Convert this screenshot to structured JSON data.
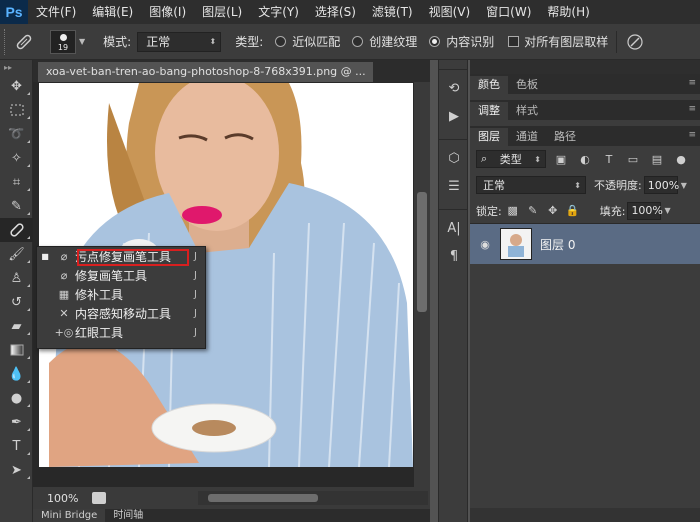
{
  "menubar": {
    "logo": "Ps",
    "items": [
      "文件(F)",
      "编辑(E)",
      "图像(I)",
      "图层(L)",
      "文字(Y)",
      "选择(S)",
      "滤镜(T)",
      "视图(V)",
      "窗口(W)",
      "帮助(H)"
    ]
  },
  "options": {
    "brush_size": "19",
    "mode_label": "模式:",
    "mode_value": "正常",
    "type_label": "类型:",
    "radio_proximity": "近似匹配",
    "radio_texture": "创建纹理",
    "radio_content_aware": "内容识别",
    "sample_all_layers": "对所有图层取样"
  },
  "document": {
    "tab_title": "xoa-vet-ban-tren-ao-bang-photoshop-8-768x391.png @ ...",
    "zoom": "100%"
  },
  "bottom_tabs": [
    "Mini Bridge",
    "时间轴"
  ],
  "flyout": {
    "items": [
      {
        "label": "污点修复画笔工具",
        "key": "J"
      },
      {
        "label": "修复画笔工具",
        "key": "J"
      },
      {
        "label": "修补工具",
        "key": "J"
      },
      {
        "label": "内容感知移动工具",
        "key": "J"
      },
      {
        "label": "红眼工具",
        "key": "J"
      }
    ]
  },
  "panels": {
    "row1_tabs": [
      "颜色",
      "色板"
    ],
    "row2_tabs": [
      "调整",
      "样式"
    ],
    "layers_tabs": [
      "图层",
      "通道",
      "路径"
    ],
    "kind_label": "类型",
    "blend_mode": "正常",
    "opacity_label": "不透明度:",
    "opacity_value": "100%",
    "lock_label": "锁定:",
    "fill_label": "填充:",
    "fill_value": "100%",
    "layer_name": "图层 0"
  }
}
